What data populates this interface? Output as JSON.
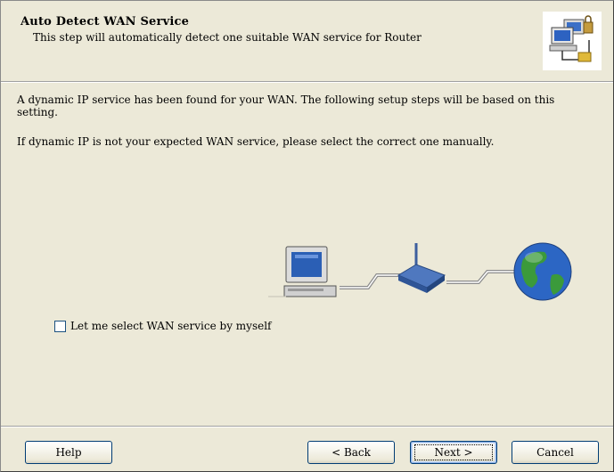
{
  "header": {
    "title": "Auto Detect WAN Service",
    "subtitle": "This step will automatically detect one suitable WAN service for Router",
    "icon": "network-computers-icon"
  },
  "body": {
    "line1": "A dynamic IP service has been found for your WAN. The following setup steps will be based on this setting.",
    "line2": "If dynamic IP is not your expected WAN service, please select the correct one manually."
  },
  "illustration": {
    "items": [
      "computer-icon",
      "router-icon",
      "globe-icon"
    ]
  },
  "checkbox": {
    "label": "Let me select WAN service by myself",
    "checked": false
  },
  "buttons": {
    "help": "Help",
    "back": "< Back",
    "next": "Next >",
    "cancel": "Cancel"
  }
}
